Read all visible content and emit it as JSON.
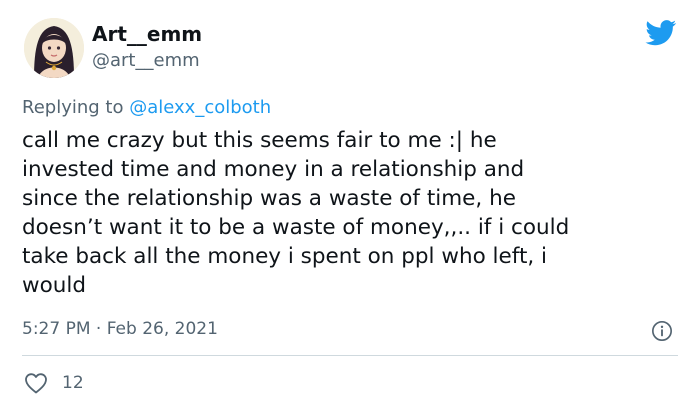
{
  "tweet": {
    "author": {
      "display_name": "Art__emm",
      "handle": "@art__emm",
      "avatar_icon": "illustrated-avatar"
    },
    "reply_prefix": "Replying to",
    "reply_to": "@alexx_colboth",
    "text": "call me crazy but this seems fair to me :| he\ninvested time and money in a relationship and\nsince the relationship was a waste of time, he\ndoesn’t want it to be a waste of money,,.. if i could\ntake back all the money i spent on ppl who left, i\nwould",
    "timestamp": "5:27 PM · Feb 26, 2021",
    "likes": "12"
  },
  "icons": {
    "brand": "twitter-bird-icon",
    "info": "info-icon",
    "like": "heart-icon"
  },
  "colors": {
    "brand_blue": "#1d9bf0",
    "text_primary": "#0f1419",
    "text_secondary": "#536471",
    "divider": "#cfd9de"
  }
}
